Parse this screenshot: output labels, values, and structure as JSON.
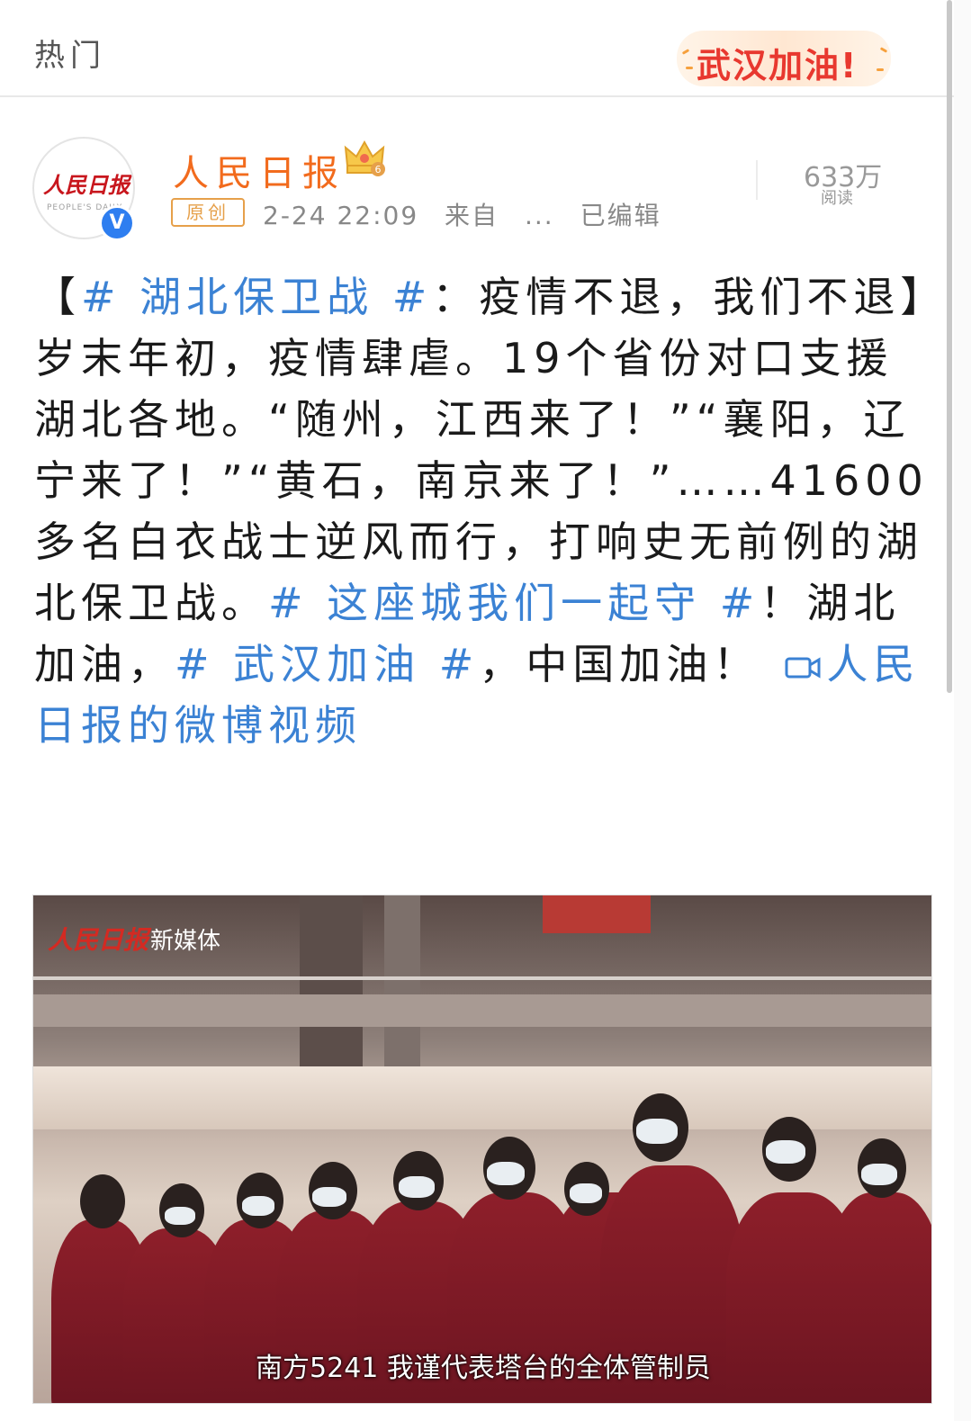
{
  "topbar": {
    "title": "热门",
    "banner_text": "武汉加油!"
  },
  "post": {
    "author": "人民日报",
    "avatar_logo": "人民日报",
    "avatar_sub": "PEOPLE'S DAILY",
    "verified_mark": "V",
    "badge": "原创",
    "time": "2-24 22:09",
    "source_label": "来自",
    "source_value": "...",
    "edited": "已编辑",
    "reads_count": "633万",
    "reads_label": "阅读",
    "text": {
      "open_bracket": "【",
      "tag1": "# 湖北保卫战 #",
      "part1": "：疫情不退，我们不退】岁末年初，疫情肆虐。19个省份对口支援湖北各地。“随州，江西来了！”“襄阳，辽宁来了！”“黄石，南京来了！”……41600多名白衣战士逆风而行，打响史无前例的湖北保卫战。",
      "tag2": "# 这座城我们一起守 #",
      "part2": "！湖北加油，",
      "tag3": "# 武汉加油 #",
      "part3": "，中国加油！",
      "video_link": "人民日报的微博视频"
    }
  },
  "video": {
    "logo": "人民日报",
    "logo_sub": "新媒体",
    "subtitle": "南方5241 我谨代表塔台的全体管制员"
  },
  "colors": {
    "accent_orange": "#f26b1d",
    "link_blue": "#3b82d4",
    "banner_red": "#e8382f"
  }
}
